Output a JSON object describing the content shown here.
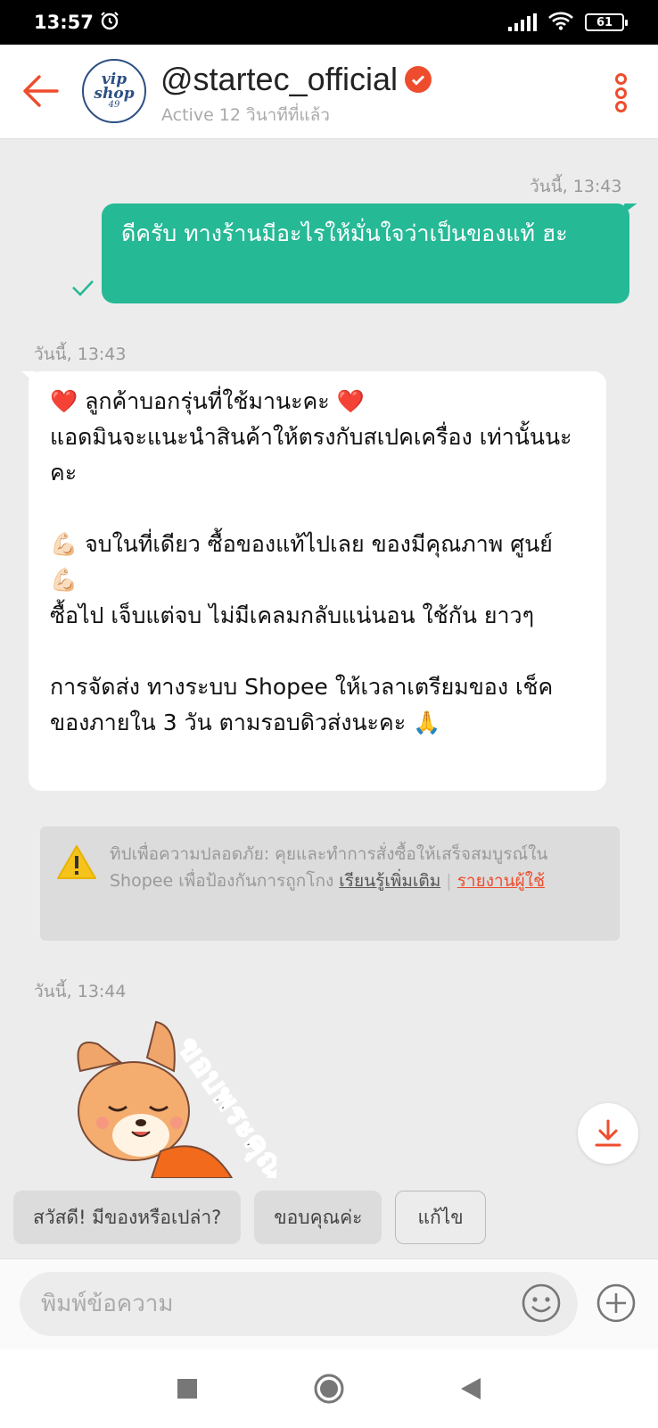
{
  "status_bar": {
    "time": "13:57",
    "battery": "61"
  },
  "header": {
    "avatar_line1": "vip",
    "avatar_line2": "shop",
    "avatar_line3": "49",
    "shop_name": "@startec_official",
    "active_status": "Active 12 วินาทีที่แล้ว"
  },
  "messages": {
    "out_time": "วันนี้, 13:43",
    "out_text": "ดีครับ ทางร้านมีอะไรให้มั่นใจว่าเป็นของแท้ ฮะ",
    "in_time": "วันนี้, 13:43",
    "in_text": "❤️ ลูกค้าบอกรุ่นที่ใช้มานะคะ ❤️\nแอดมินจะแนะนำสินค้าให้ตรงกับสเปคเครื่อง เท่านั้นนะคะ\n\n💪🏻 จบในที่เดียว ซื้อของแท้ไปเลย ของมีคุณภาพ ศูนย์ 💪🏻\nซื้อไป เจ็บแต่จบ ไม่มีเคลมกลับแน่นอน ใช้กัน ยาวๆ\n\nการจัดส่ง ทางระบบ Shopee ให้เวลาเตรียมของ เช็คของภายใน 3 วัน ตามรอบดิวส่งนะคะ 🙏",
    "sticker_time": "วันนี้, 13:44",
    "sticker_text": "ขอบพระคุณ"
  },
  "safety_tip": {
    "text": "ทิปเพื่อความปลอดภัย: คุยและทำการสั่งซื้อให้เสร็จสมบูรณ์ใน Shopee เพื่อป้องกันการถูกโกง ",
    "learn_more": "เรียนรู้เพิ่มเติม",
    "separator": " | ",
    "report": "รายงานผู้ใช้"
  },
  "quick_replies": [
    "สวัสดี! มีของหรือเปล่า?",
    "ขอบคุณค่ะ",
    "แก้ไข"
  ],
  "input": {
    "placeholder": "พิมพ์ข้อความ"
  },
  "colors": {
    "accent": "#ee4d2d",
    "outgoing_bubble": "#26b996",
    "background": "#ececec"
  }
}
